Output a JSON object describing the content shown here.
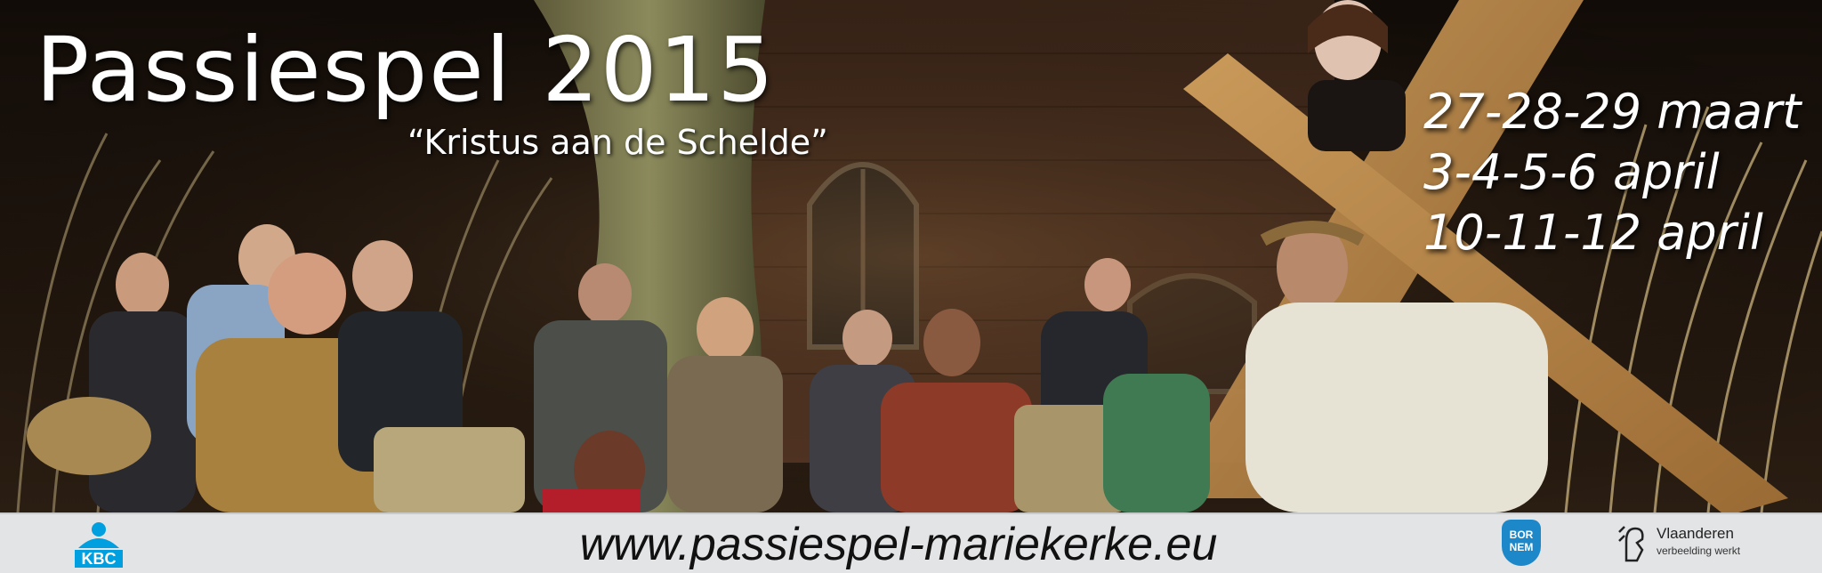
{
  "banner": {
    "title": "Passiespel 2015",
    "subtitle": "“Kristus aan de Schelde”",
    "dates": [
      "27-28-29 maart",
      "3-4-5-6 april",
      "10-11-12 april"
    ]
  },
  "footer": {
    "url": "www.passiespel-mariekerke.eu",
    "sponsors": {
      "kbc": "KBC",
      "bornem": [
        "BOR",
        "NEM"
      ],
      "vlaanderen_name": "Vlaanderen",
      "vlaanderen_tagline": "verbeelding werkt"
    }
  },
  "colors": {
    "title": "#ffffff",
    "footer_background": "#e3e4e6",
    "kbc_blue": "#009fdf",
    "bornem_blue": "#1d88c9"
  }
}
